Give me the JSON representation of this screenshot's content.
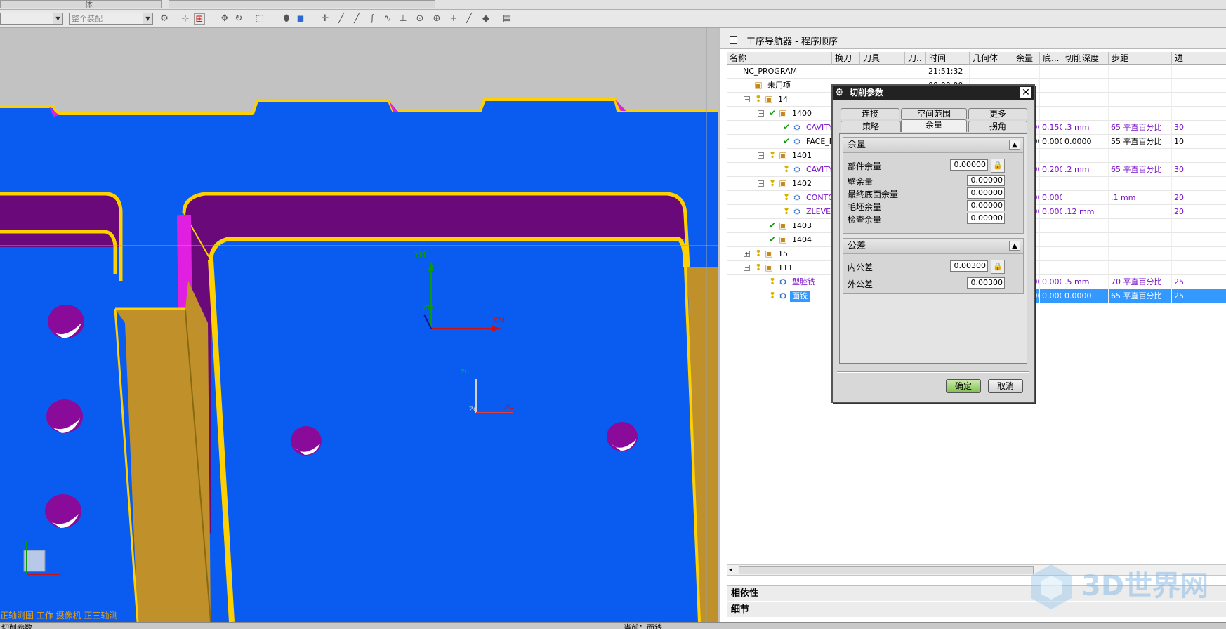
{
  "toolbar": {
    "combo1_value": "",
    "combo2_value": "整个装配",
    "top_label": "体"
  },
  "viewport": {
    "axis_labels": {
      "ym": "YM",
      "xm": "XM",
      "zm": "ZM",
      "yc": "YC",
      "xc": "XC",
      "zc": "ZC"
    },
    "caption": "正轴测图 工作 摄像机 正三轴测",
    "colors": {
      "floor": "#0a5cf0",
      "wall": "#6a0a7a",
      "edge": "#ffd000",
      "rib": "#c0902a",
      "top": "#c0c0c0",
      "magenta": "#e020e0"
    }
  },
  "statusbar": {
    "left": "切削参数",
    "mid": "当前：面铣"
  },
  "navigator": {
    "title": "工序导航器 - 程序顺序",
    "columns": [
      "名称",
      "换刀",
      "刀具",
      "刀..",
      "时间",
      "几何体",
      "余量",
      "底...",
      "切削深度",
      "步距",
      "进"
    ],
    "rows": [
      {
        "name": "NC_PROGRAM",
        "indent": 0,
        "exp": "",
        "icons": [],
        "time": "21:51:32",
        "cols": [
          "",
          "",
          "",
          "",
          "",
          ""
        ]
      },
      {
        "name": "未用项",
        "indent": 1,
        "exp": "",
        "icons": [
          "folder"
        ],
        "time": "00:00:00",
        "cols": [
          "",
          "",
          "",
          "",
          "",
          ""
        ]
      },
      {
        "name": "14",
        "indent": 1,
        "exp": "−",
        "icons": [
          "bulb",
          "folder"
        ],
        "time": "",
        "cols": [
          "",
          "",
          "",
          "",
          "",
          ""
        ]
      },
      {
        "name": "1400",
        "indent": 2,
        "exp": "−",
        "icons": [
          "check",
          "folder"
        ],
        "time": "",
        "cols": [
          "",
          "",
          "",
          "",
          "",
          ""
        ]
      },
      {
        "name": "CAVITY_MI...",
        "indent": 3,
        "exp": "",
        "icons": [
          "check",
          "op"
        ],
        "purple": true,
        "time": "",
        "cols": [
          "0.1500",
          "0.1500",
          ".3 mm",
          "65 平直百分比",
          "30"
        ]
      },
      {
        "name": "FACE_MILL...",
        "indent": 3,
        "exp": "",
        "icons": [
          "check",
          "op"
        ],
        "purple": false,
        "time": "",
        "cols": [
          "0.0000",
          "0.0000",
          "0.0000",
          "55 平直百分比",
          "10"
        ]
      },
      {
        "name": "1401",
        "indent": 2,
        "exp": "−",
        "icons": [
          "bulb",
          "folder"
        ],
        "time": "",
        "cols": [
          "",
          "",
          "",
          "",
          ""
        ]
      },
      {
        "name": "CAVITY_MI...",
        "indent": 3,
        "exp": "",
        "icons": [
          "bulb",
          "op"
        ],
        "purple": true,
        "time": "",
        "cols": [
          "0.2000",
          "0.2000",
          ".2 mm",
          "65 平直百分比",
          "30"
        ]
      },
      {
        "name": "1402",
        "indent": 2,
        "exp": "−",
        "icons": [
          "bulb",
          "folder"
        ],
        "time": "",
        "cols": [
          "",
          "",
          "",
          "",
          ""
        ]
      },
      {
        "name": "CONTOUR_A...",
        "indent": 3,
        "exp": "",
        "icons": [
          "bulb",
          "op"
        ],
        "purple": true,
        "time": "",
        "cols": [
          "0.0000",
          "0.0000",
          "",
          ".1 mm",
          "20"
        ]
      },
      {
        "name": "ZLEVEL_PR...",
        "indent": 3,
        "exp": "",
        "icons": [
          "bulb",
          "op"
        ],
        "purple": true,
        "time": "",
        "cols": [
          "0.0000",
          "0.0000",
          ".12 mm",
          "",
          "20"
        ]
      },
      {
        "name": "1403",
        "indent": 2,
        "exp": "",
        "icons": [
          "check",
          "folder"
        ],
        "time": "",
        "cols": [
          "",
          "",
          "",
          "",
          ""
        ]
      },
      {
        "name": "1404",
        "indent": 2,
        "exp": "",
        "icons": [
          "check",
          "folder"
        ],
        "time": "",
        "cols": [
          "",
          "",
          "",
          "",
          ""
        ]
      },
      {
        "name": "15",
        "indent": 1,
        "exp": "+",
        "icons": [
          "bulb",
          "folder"
        ],
        "time": "",
        "cols": [
          "",
          "",
          "",
          "",
          ""
        ]
      },
      {
        "name": "111",
        "indent": 1,
        "exp": "−",
        "icons": [
          "bulb",
          "folder"
        ],
        "time": "",
        "cols": [
          "",
          "",
          "",
          "",
          ""
        ]
      },
      {
        "name": "型腔铣",
        "indent": 2,
        "exp": "",
        "icons": [
          "bulb",
          "op"
        ],
        "purple": true,
        "time": "",
        "cols": [
          "0.1500",
          "0.0000",
          ".5 mm",
          "70 平直百分比",
          "25"
        ]
      },
      {
        "name": "面铣",
        "indent": 2,
        "exp": "",
        "icons": [
          "bulb",
          "op"
        ],
        "purple": false,
        "selected": true,
        "time": "",
        "cols": [
          "0.0000",
          "0.0000",
          "0.0000",
          "65 平直百分比",
          "25"
        ]
      }
    ],
    "panels": [
      "相依性",
      "细节"
    ]
  },
  "dialog": {
    "title": "切削参数",
    "tabs_row1": [
      "连接",
      "空间范围",
      "更多"
    ],
    "tabs_row2": [
      "策略",
      "余量",
      "拐角"
    ],
    "active_tab": "余量",
    "group1": {
      "title": "余量",
      "fields": [
        {
          "label": "部件余量",
          "value": "0.00000",
          "lock": true
        },
        {
          "label": "壁余量",
          "value": "0.00000",
          "lock": false
        },
        {
          "label": "最终底面余量",
          "value": "0.00000",
          "lock": false
        },
        {
          "label": "毛坯余量",
          "value": "0.00000",
          "lock": false
        },
        {
          "label": "检查余量",
          "value": "0.00000",
          "lock": false
        }
      ]
    },
    "group2": {
      "title": "公差",
      "fields": [
        {
          "label": "内公差",
          "value": "0.00300",
          "lock": true
        },
        {
          "label": "外公差",
          "value": "0.00300",
          "lock": false
        }
      ]
    },
    "ok_label": "确定",
    "cancel_label": "取消"
  },
  "watermark": "3D世界网"
}
